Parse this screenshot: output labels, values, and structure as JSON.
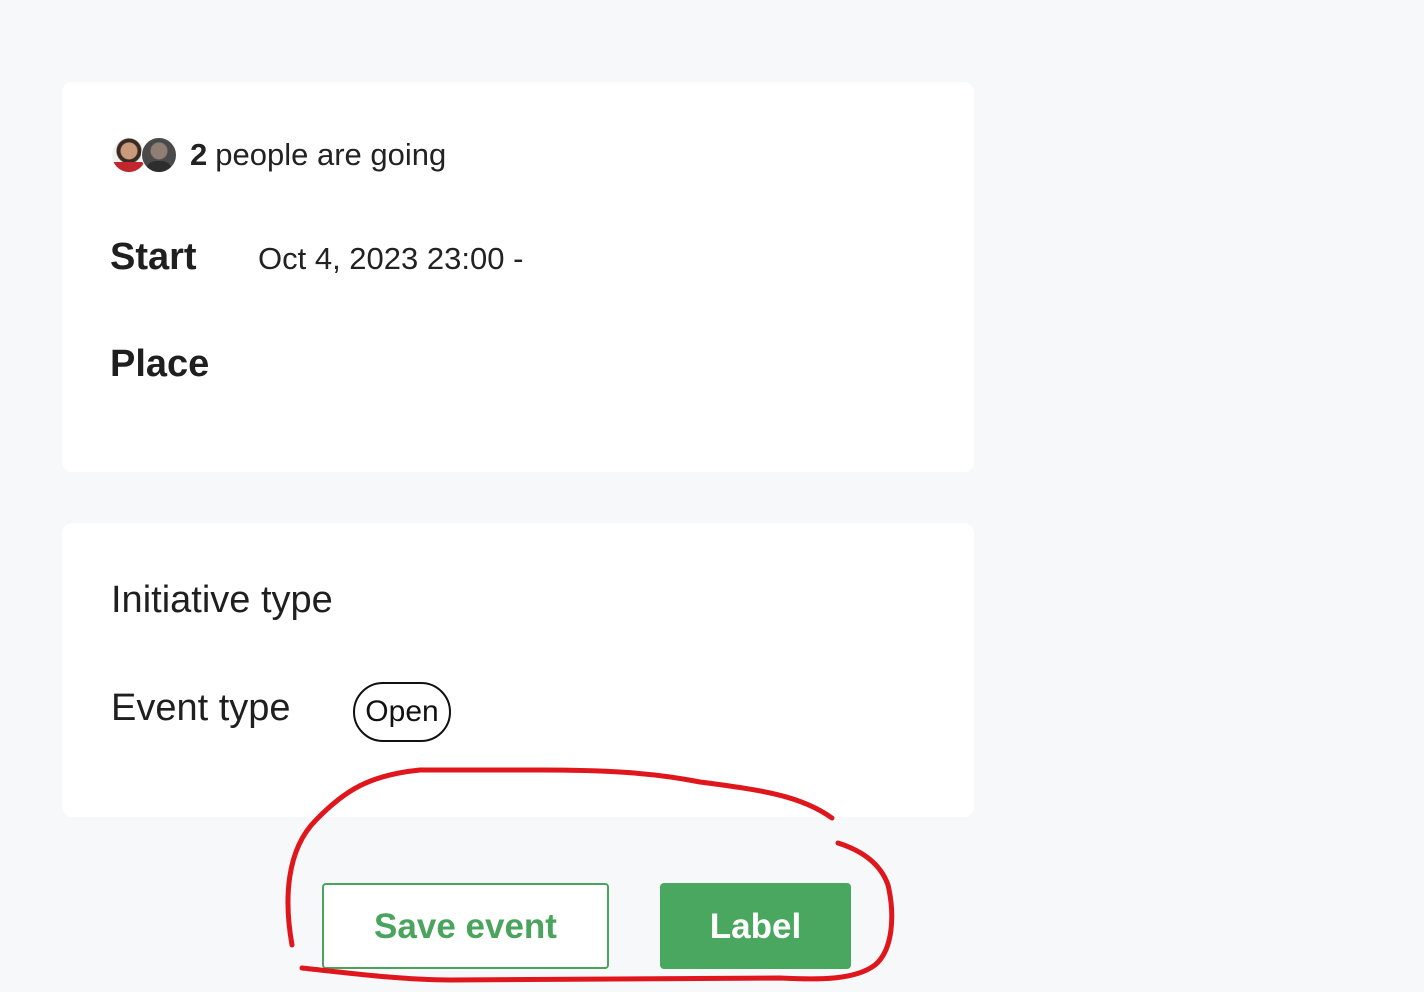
{
  "attendees": {
    "count": "2",
    "text": "people are going",
    "avatars": [
      "avatar-1",
      "avatar-2"
    ]
  },
  "details": {
    "start_label": "Start",
    "start_value": "Oct 4, 2023 23:00 -",
    "place_label": "Place"
  },
  "types": {
    "initiative_label": "Initiative type",
    "event_label": "Event type",
    "event_value": "Open"
  },
  "actions": {
    "save_label": "Save event",
    "label_button": "Label"
  },
  "colors": {
    "background": "#f7f8fa",
    "card": "#ffffff",
    "accent_green": "#4aa760",
    "annotation_red": "#e0161d"
  }
}
